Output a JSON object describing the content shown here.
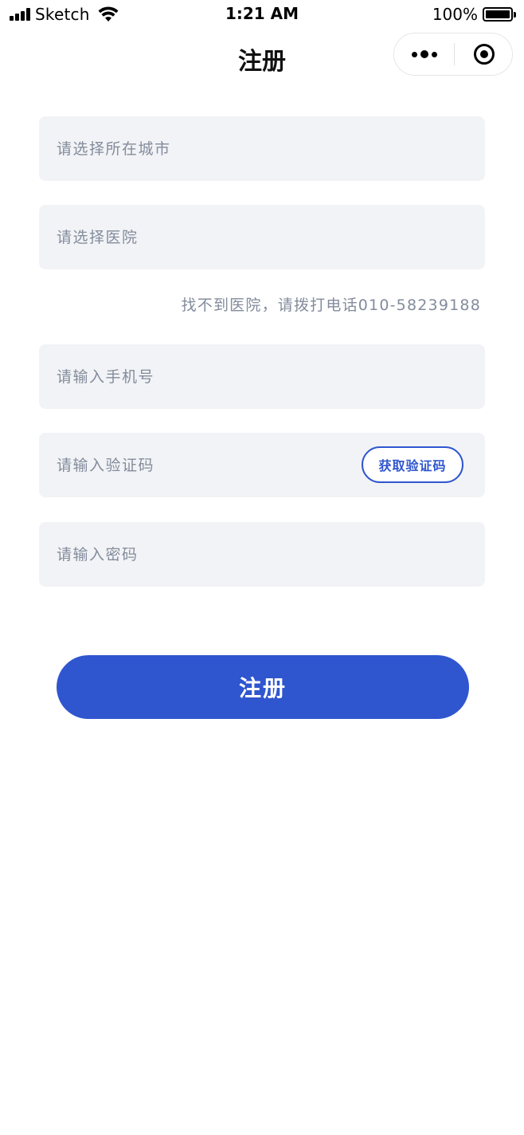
{
  "status_bar": {
    "carrier": "Sketch",
    "time": "1:21 AM",
    "battery": "100%",
    "icons": [
      "signal-icon",
      "wifi-icon",
      "battery-icon"
    ]
  },
  "nav": {
    "title": "注册",
    "capsule_icons": [
      "more-icon",
      "close-miniprogram-icon"
    ]
  },
  "form": {
    "city_placeholder": "请选择所在城市",
    "hospital_placeholder": "请选择医院",
    "hospital_hint": "找不到医院，请拨打电话010-58239188",
    "phone_placeholder": "请输入手机号",
    "code_placeholder": "请输入验证码",
    "get_code_label": "获取验证码",
    "password_placeholder": "请输入密码",
    "submit_label": "注册"
  },
  "colors": {
    "primary": "#2f56cf",
    "field_bg": "#f2f3f6",
    "placeholder": "#838c9c"
  }
}
